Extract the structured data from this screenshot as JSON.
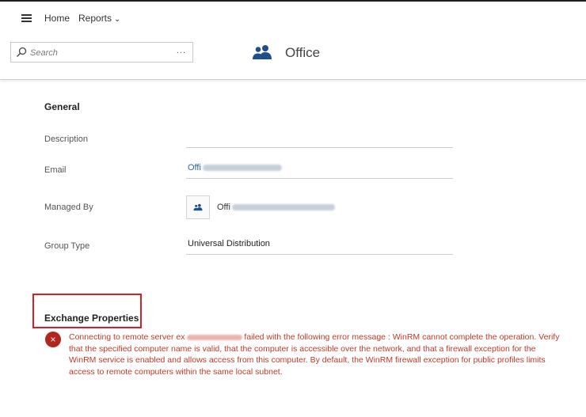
{
  "nav": {
    "home": "Home",
    "reports": "Reports",
    "reports_chevron": "⌄"
  },
  "search": {
    "placeholder": "Search",
    "more": "..."
  },
  "header": {
    "title": "Office",
    "icon": "group-icon"
  },
  "general": {
    "heading": "General",
    "description_label": "Description",
    "description_value": "",
    "email_label": "Email",
    "email_value": "Offi",
    "managed_by_label": "Managed By",
    "managed_by_value": "Offi",
    "group_type_label": "Group Type",
    "group_type_value": "Universal Distribution"
  },
  "exchange": {
    "heading": "Exchange Properties",
    "error_part1": "Connecting to remote server ex",
    "error_part2": " failed with the following error message : WinRM cannot complete the operation. Verify that the specified computer name is valid, that the computer is accessible over the network, and that a firewall exception for the WinRM service is enabled and allows access from this computer. By default, the WinRM firewall exception for public profiles limits access to remote computers within the same local subnet.",
    "error_icon": "error-icon",
    "error_symbol": "×"
  },
  "colors": {
    "accent_blue": "#2a5fa8",
    "error_red": "#c0392b",
    "highlight_red": "#d82020",
    "icon_blue": "#1f4e8c"
  }
}
